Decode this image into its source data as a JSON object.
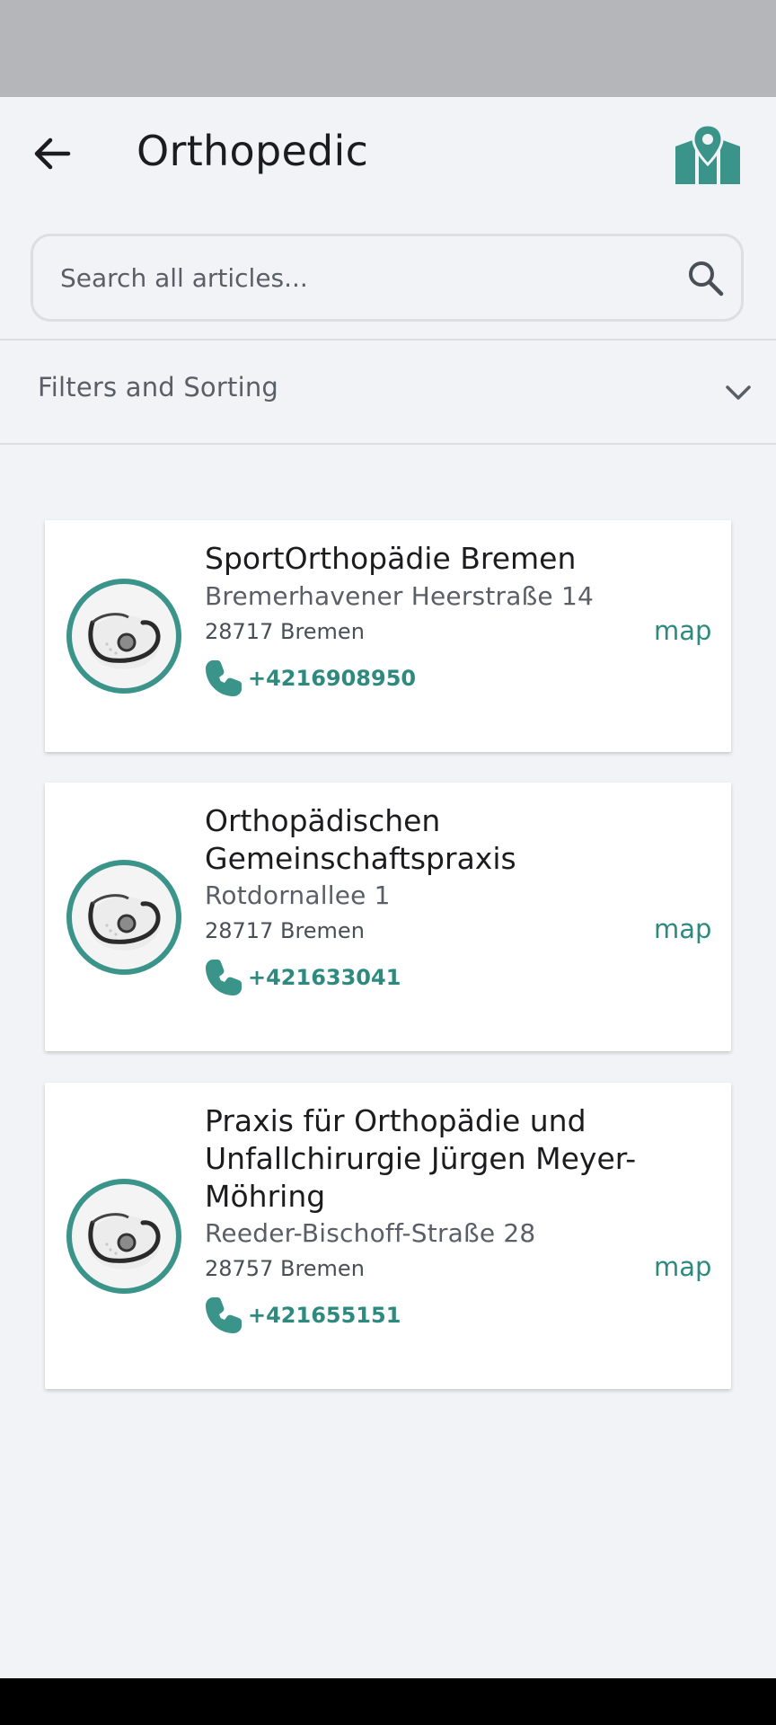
{
  "header": {
    "title": "Orthopedic"
  },
  "search": {
    "placeholder": "Search all articles..."
  },
  "filters": {
    "label": "Filters and Sorting"
  },
  "colors": {
    "accent": "#3a948a",
    "background": "#f2f3f7"
  },
  "cards": [
    {
      "name": "SportOrthopädie Bremen",
      "street": "Bremerhavener Heerstraße 14",
      "city": " 28717 Bremen",
      "phone": "+4216908950",
      "map_label": "map"
    },
    {
      "name": "Orthopädischen Gemeinschaftspraxis",
      "street": "Rotdornallee 1",
      "city": "28717 Bremen",
      "phone": "+421633041",
      "map_label": "map"
    },
    {
      "name": "Praxis für Orthopädie und Unfallchirurgie Jürgen Meyer-Möhring",
      "street": "Reeder-Bischoff-Straße 28",
      "city": "28757 Bremen",
      "phone": "+421655151",
      "map_label": "map"
    }
  ]
}
